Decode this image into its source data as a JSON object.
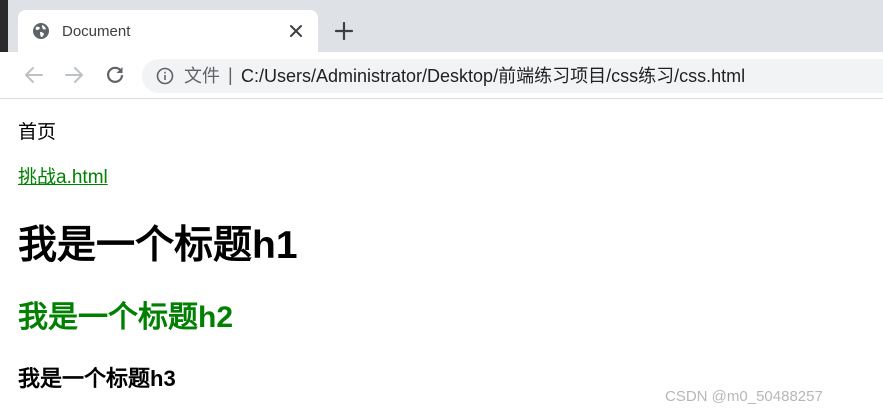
{
  "browser": {
    "tab": {
      "title": "Document",
      "favicon": "globe-icon"
    },
    "toolbar": {
      "back_icon": "back-arrow-icon",
      "forward_icon": "forward-arrow-icon",
      "reload_icon": "reload-icon",
      "info_icon": "info-icon",
      "url_scheme": "文件",
      "url_separator": "|",
      "url": "C:/Users/Administrator/Desktop/前端练习项目/css练习/css.html"
    },
    "new_tab_icon": "plus-icon",
    "close_tab_icon": "close-icon"
  },
  "page": {
    "home_text": "首页",
    "challenge_link": "挑战a.html",
    "heading1": "我是一个标题h1",
    "heading2": "我是一个标题h2",
    "heading3": "我是一个标题h3",
    "link_color": "#008000",
    "heading2_color": "#008000"
  },
  "watermark": "CSDN @m0_50488257"
}
